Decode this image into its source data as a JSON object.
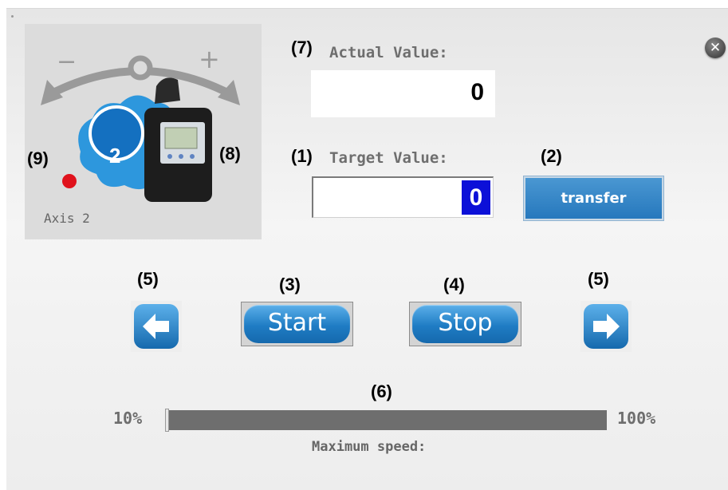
{
  "window": {
    "close_icon": "close-icon"
  },
  "axis_card": {
    "knob_number": "2",
    "label": "Axis 2",
    "minus": "−",
    "plus": "+"
  },
  "callouts": {
    "c1": "(1)",
    "c2": "(2)",
    "c3": "(3)",
    "c4": "(4)",
    "c5_left": "(5)",
    "c5_right": "(5)",
    "c6": "(6)",
    "c7": "(7)",
    "c8": "(8)",
    "c9": "(9)"
  },
  "actual": {
    "label": "Actual Value:",
    "value": "0"
  },
  "target": {
    "label": "Target Value:",
    "value": "0"
  },
  "buttons": {
    "transfer": "transfer",
    "start": "Start",
    "stop": "Stop"
  },
  "speed": {
    "min_label": "10%",
    "max_label": "100%",
    "label": "Maximum speed:",
    "level_percent": 10
  },
  "colors": {
    "accent": "#1f7cc4",
    "status_dot": "#e0121c",
    "target_highlight": "#0c10d8"
  }
}
